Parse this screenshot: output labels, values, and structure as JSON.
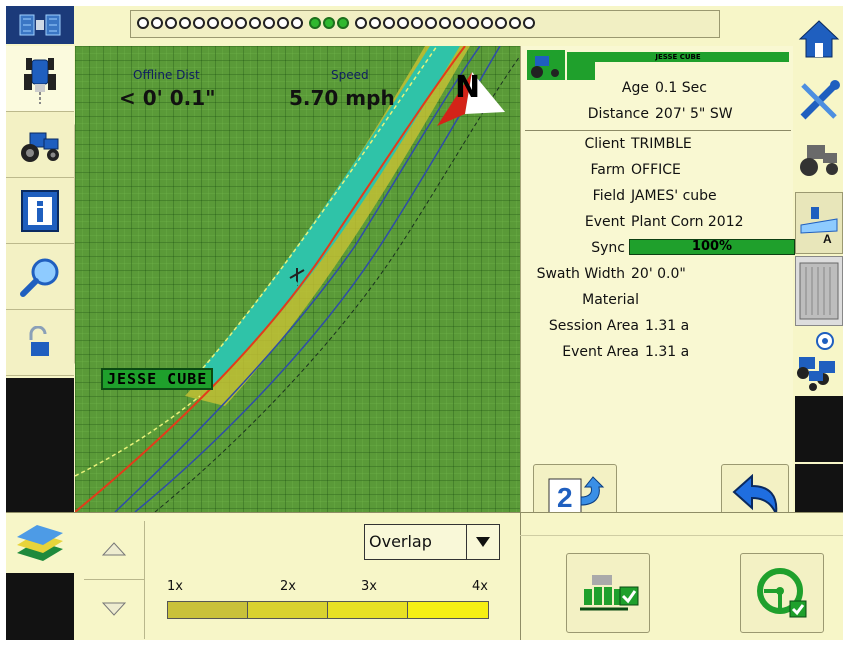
{
  "top_bar": {
    "led_count_left": 12,
    "led_count_green": 3,
    "led_count_right": 13
  },
  "left_toolbar": {
    "items": [
      "guidance-tab",
      "vehicle-tab",
      "info-tab",
      "search-tab",
      "lock-tab"
    ]
  },
  "map": {
    "offline_label": "Offline Dist",
    "offline_value": "< 0' 0.1\"",
    "speed_label": "Speed",
    "speed_value": "5.70 mph",
    "compass_letter": "N",
    "vehicle_tag": "JESSE CUBE"
  },
  "info_panel": {
    "vehicle_name": "JESSE CUBE",
    "age_label": "Age",
    "age_value": "0.1 Sec",
    "distance_label": "Distance",
    "distance_value": "207' 5\" SW",
    "client_label": "Client",
    "client_value": "TRIMBLE",
    "farm_label": "Farm",
    "farm_value": "OFFICE",
    "field_label": "Field",
    "field_value": "JAMES' cube",
    "event_label": "Event",
    "event_value": "Plant Corn 2012",
    "sync_label": "Sync",
    "sync_value": "100%",
    "swath_label": "Swath Width",
    "swath_value": "20' 0.0\"",
    "material_label": "Material",
    "material_value": "",
    "session_area_label": "Session Area",
    "session_area_value": "1.31 a",
    "event_area_label": "Event Area",
    "event_area_value": "1.31 a"
  },
  "bottom": {
    "layer_dropdown_value": "Overlap",
    "legend": [
      "1x",
      "2x",
      "3x",
      "4x"
    ],
    "legend_colors": [
      "#c9c13a",
      "#d9d230",
      "#e8e024",
      "#f5ef14"
    ]
  },
  "colors": {
    "panel_bg": "#f7f6c8",
    "green_accent": "#1fa02c",
    "map_green": "#5a9a38"
  }
}
